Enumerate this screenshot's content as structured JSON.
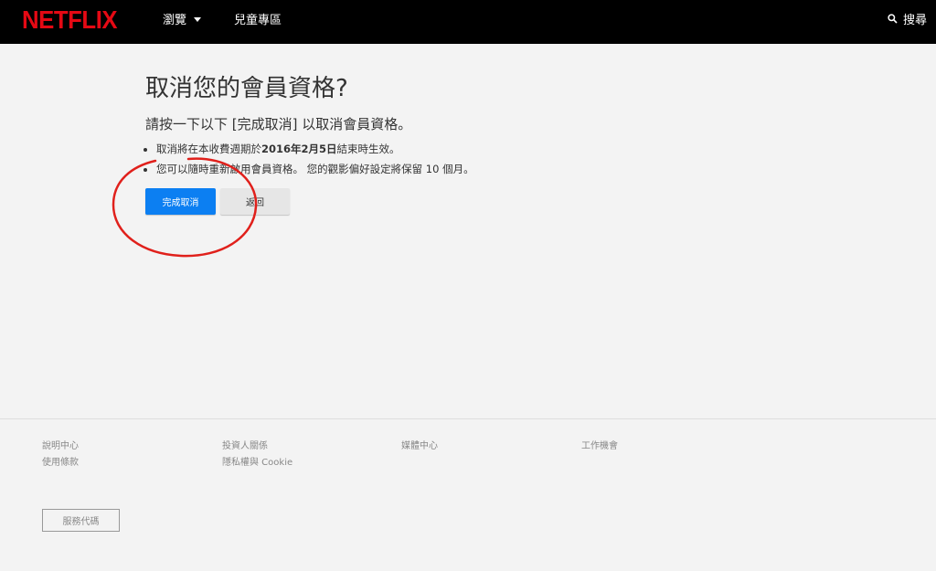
{
  "header": {
    "logo": "NETFLIX",
    "browse_label": "瀏覽",
    "kids_label": "兒童專區",
    "search_label": "搜尋"
  },
  "main": {
    "title": "取消您的會員資格?",
    "lead": "請按一下以下 [完成取消] 以取消會員資格。",
    "note1_prefix": "取消將在本收費週期於",
    "note1_date": "2016年2月5日",
    "note1_suffix": "結束時生效。",
    "note2": "您可以隨時重新啟用會員資格。 您的觀影偏好設定將保留 10 個月。",
    "finish_button": "完成取消",
    "back_button": "返回"
  },
  "footer": {
    "links": [
      "說明中心",
      "使用條款",
      "投資人關係",
      "隱私權與 Cookie",
      "媒體中心",
      "工作機會"
    ],
    "service_code": "服務代碼"
  },
  "colors": {
    "brand": "#e50914",
    "primary_button": "#0c7ff2",
    "annotation": "#e0201b"
  }
}
